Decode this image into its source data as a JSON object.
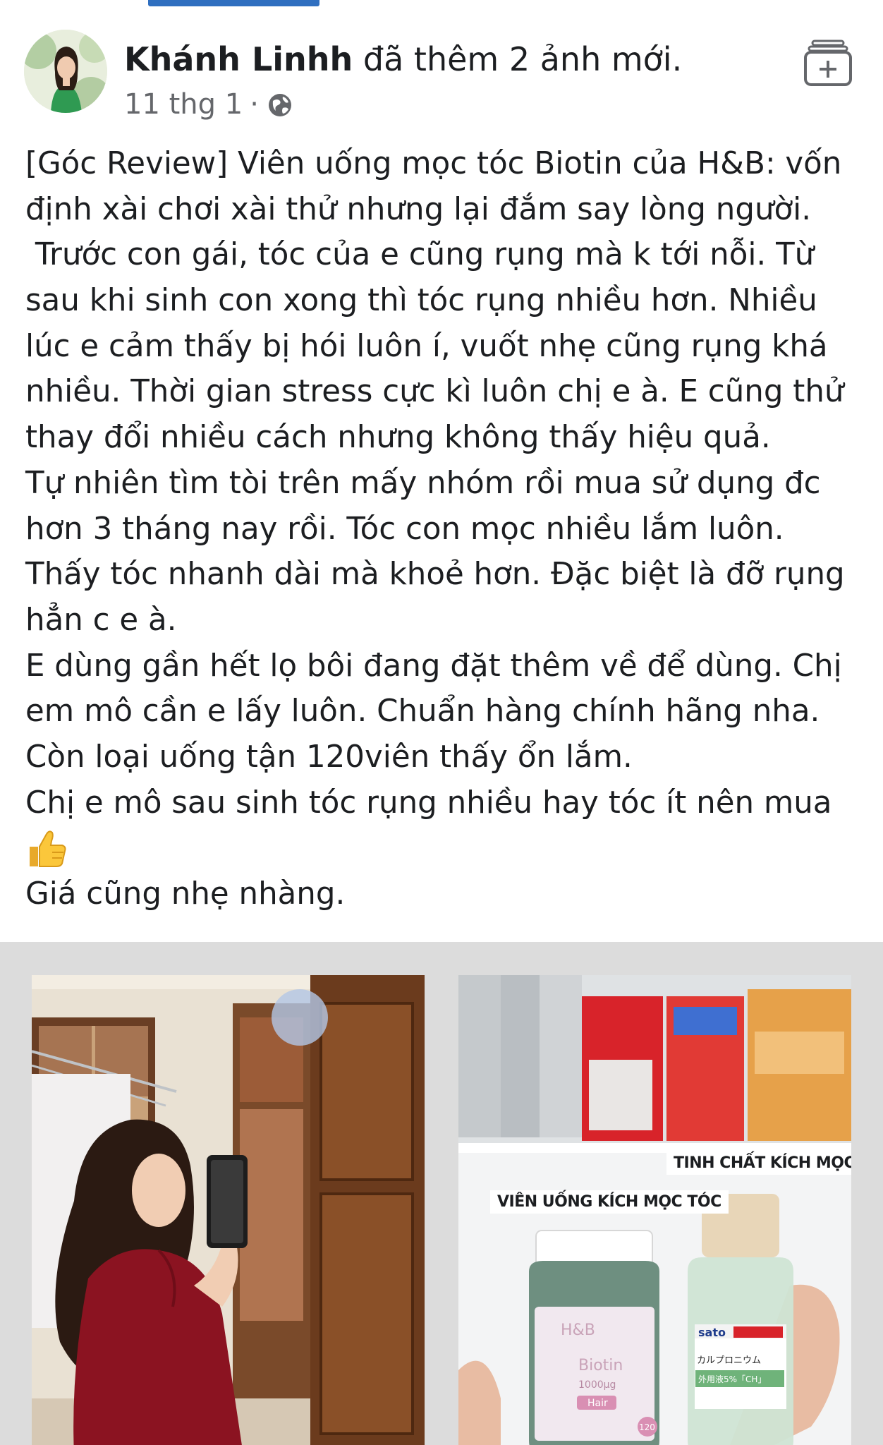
{
  "post": {
    "author_name": "Khánh Linhh",
    "action_text": "đã thêm 2 ảnh mới.",
    "timestamp": "11 thg 1",
    "separator": "·",
    "privacy_icon": "globe-icon",
    "top_right_icon": "add-to-album-icon",
    "text_lines": [
      "[Góc Review] Viên uống mọc tóc Biotin của H&B: vốn",
      "định xài chơi xài thử nhưng lại đắm say lòng người.",
      " Trước con gái, tóc của e cũng rụng mà k tới nỗi. Từ",
      "sau khi sinh con xong thì tóc rụng nhiều hơn. Nhiều",
      "lúc e cảm thấy bị hói luôn í, vuốt nhẹ cũng rụng khá",
      "nhiều. Thời gian stress cực kì luôn chị e à. E cũng thử",
      "thay đổi nhiều cách nhưng không thấy hiệu quả.",
      "Tự nhiên tìm tòi trên mấy nhóm rồi mua sử dụng đc",
      "hơn 3 tháng nay rồi. Tóc con mọc nhiều lắm luôn.",
      "Thấy tóc nhanh dài mà khoẻ hơn. Đặc biệt là đỡ rụng",
      "hẳn c e à.",
      "E dùng gần hết lọ bôi đang đặt thêm về để dùng. Chị",
      "em mô cần e lấy luôn. Chuẩn hàng chính hãng nha.",
      "Còn loại uống tận 120viên thấy ổn lắm.",
      "Chị e mô sau sinh tóc rụng nhiều hay tóc ít nên mua"
    ],
    "emoji_line_icon": "thumbs-up-icon",
    "last_line": "Giá cũng nhẹ nhàng."
  },
  "photos": {
    "right_tag_1": "TINH CHẤT KÍCH MỌC TÓC",
    "right_tag_2": "VIÊN UỐNG KÍCH MỌC TÓC",
    "bottle_brand": "H&B",
    "bottle_name": "Biotin",
    "bottle_dose": "1000μg",
    "bottle_use": "Hair",
    "bottle_count": "120",
    "serum_brand": "sato",
    "serum_name": "カルプロニウム",
    "serum_sub": "外用液5%「CH」"
  },
  "colors": {
    "author_text": "#1c1e21",
    "meta_text": "#65676b",
    "accent": "#2f6fc0",
    "gallery_bg": "#dcdcdc"
  }
}
